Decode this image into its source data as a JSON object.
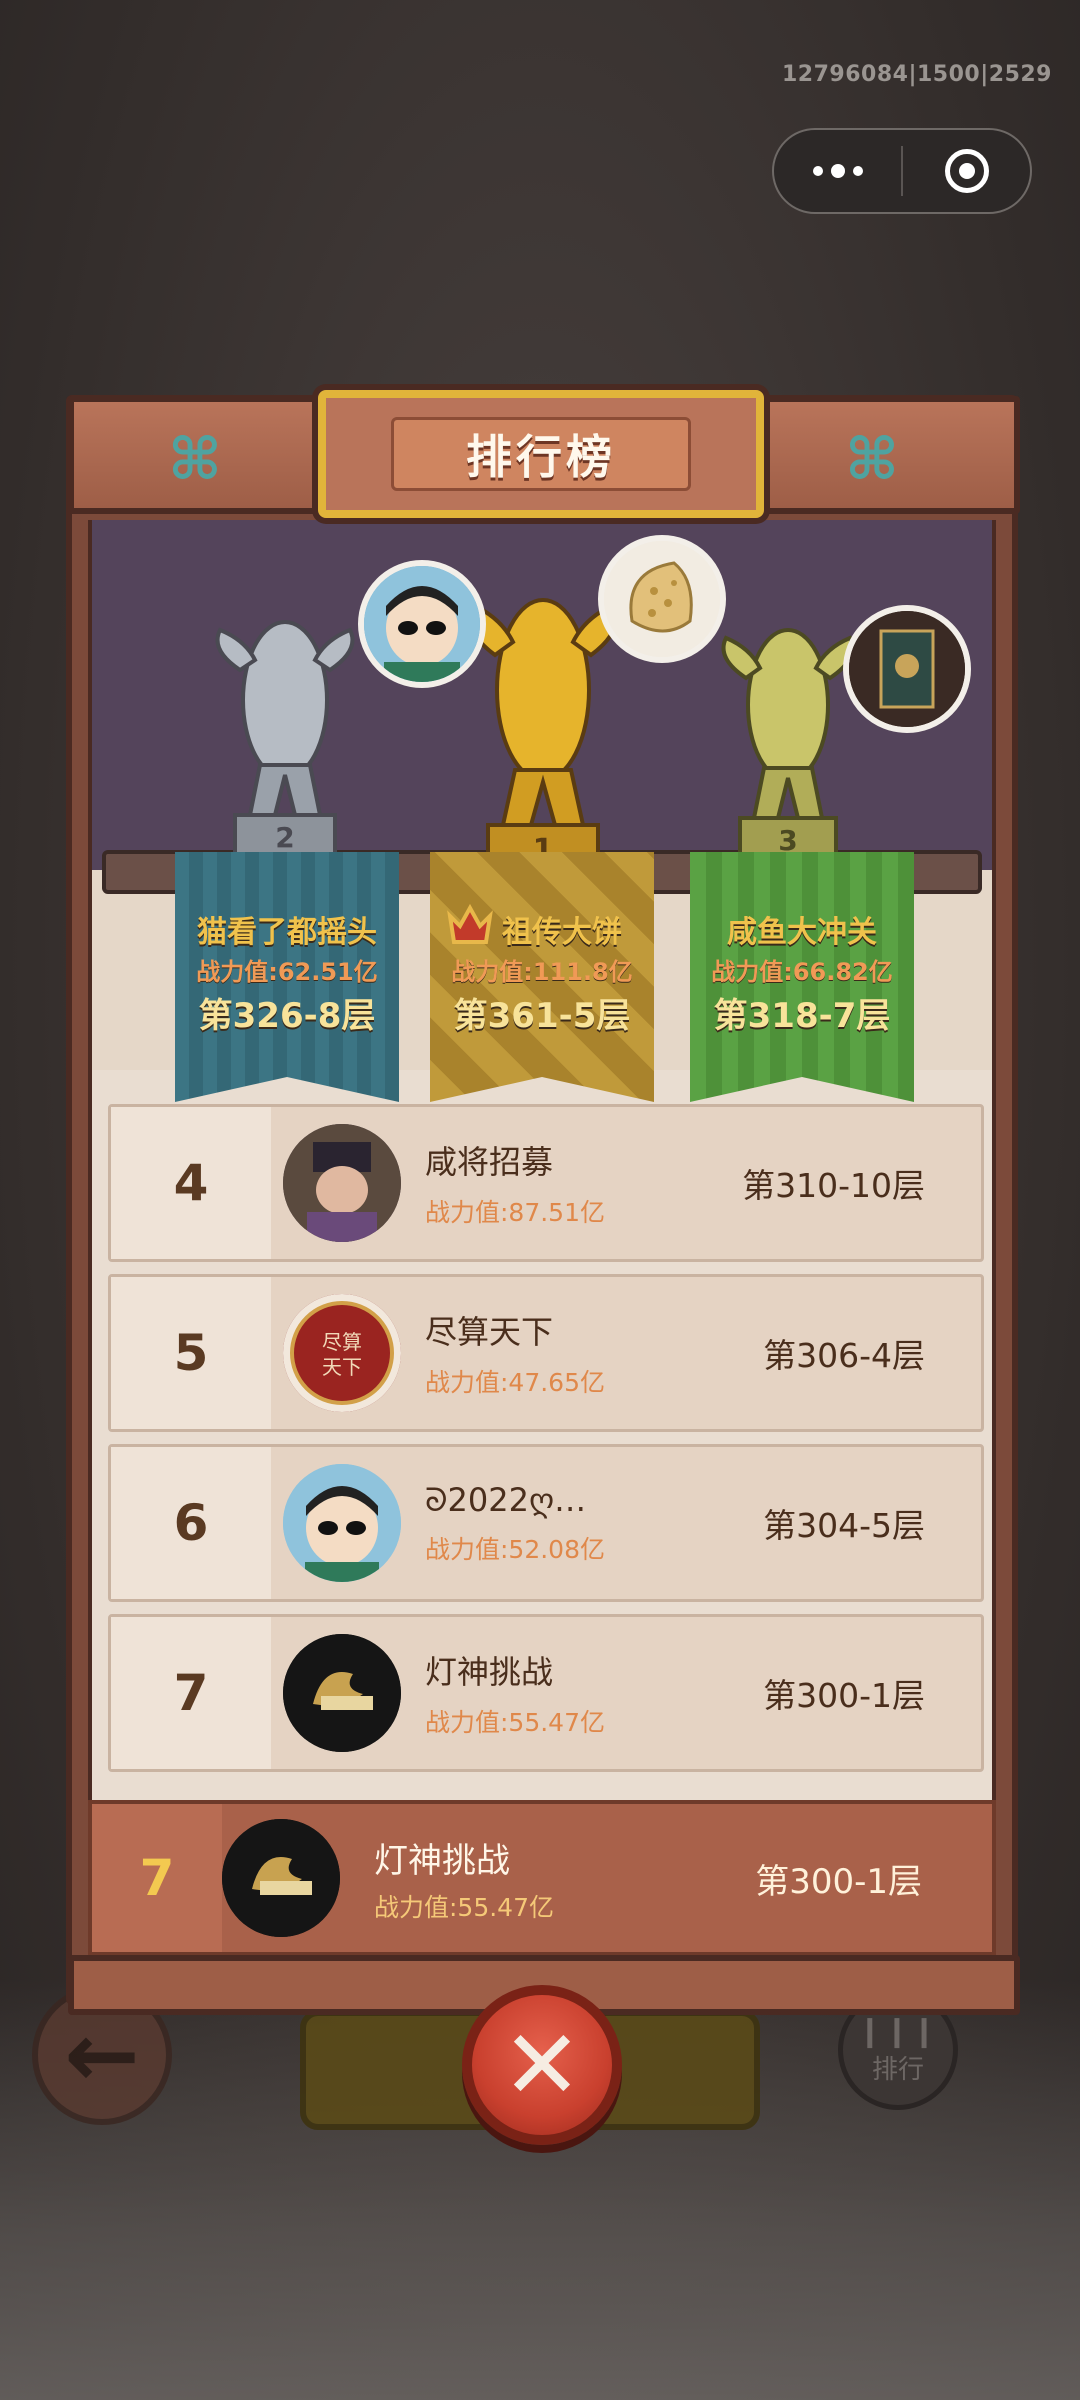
{
  "system": {
    "debug_text": "12796084|1500|2529",
    "menu_icon": "more-dots-icon",
    "close_icon": "target-circle-icon"
  },
  "modal": {
    "title": "排行榜"
  },
  "podium": [
    {
      "rank": "2",
      "name": "猫看了都摇头",
      "power": "战力值:62.51亿",
      "floor": "第326-8层"
    },
    {
      "rank": "1",
      "name": "祖传大饼",
      "power": "战力值:111.8亿",
      "floor": "第361-5层"
    },
    {
      "rank": "3",
      "name": "咸鱼大冲关",
      "power": "战力值:66.82亿",
      "floor": "第318-7层"
    }
  ],
  "list": [
    {
      "rank": "4",
      "name": "咸将招募",
      "power": "战力值:87.51亿",
      "floor": "第310-10层"
    },
    {
      "rank": "5",
      "name": "尽算天下",
      "power": "战力值:47.65亿",
      "floor": "第306-4层"
    },
    {
      "rank": "6",
      "name": "ᘐ2022ღ…",
      "power": "战力值:52.08亿",
      "floor": "第304-5层"
    },
    {
      "rank": "7",
      "name": "灯神挑战",
      "power": "战力值:55.47亿",
      "floor": "第300-1层"
    }
  ],
  "self": {
    "rank": "7",
    "name": "灯神挑战",
    "power": "战力值:55.47亿",
    "floor": "第300-1层"
  },
  "background": {
    "rank_label": "排行"
  },
  "colors": {
    "gold": "#f0c24c",
    "power": "#e0884a",
    "wood": "#9e5e47",
    "close_red": "#c9402e"
  }
}
